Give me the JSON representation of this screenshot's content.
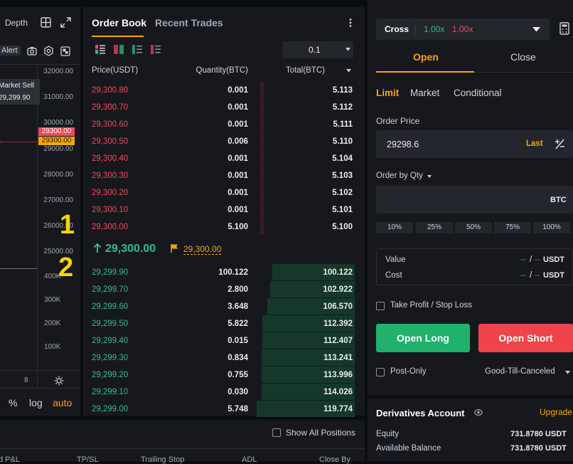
{
  "chart": {
    "depth_label": "Depth",
    "alert_label": "Alert",
    "tooltip": {
      "title": "Market Sell",
      "value": "29,299.90"
    },
    "price_axis": [
      "32000.00",
      "31000.00",
      "30000.00",
      "29000.00",
      "28000.00",
      "27000.00",
      "26000.00",
      "25000.00"
    ],
    "red_tag": "29300.00",
    "orange_tag": "29300.00",
    "volume_axis": [
      "400K",
      "300K",
      "200K",
      "100K"
    ],
    "x_tick": "8",
    "bottom_percent": "%",
    "bottom_log": "log",
    "bottom_auto": "auto",
    "marker_1": "1",
    "marker_2": "2"
  },
  "orderbook": {
    "tabs": [
      "Order Book",
      "Recent Trades"
    ],
    "precision": "0.1",
    "headers": {
      "price": "Price(USDT)",
      "qty": "Quantity(BTC)",
      "total": "Total(BTC)"
    },
    "asks": [
      {
        "price": "29,300.80",
        "qty": "0.001",
        "total": "5.113",
        "fill": 0.04
      },
      {
        "price": "29,300.70",
        "qty": "0.001",
        "total": "5.112",
        "fill": 0.04
      },
      {
        "price": "29,300.60",
        "qty": "0.001",
        "total": "5.111",
        "fill": 0.04
      },
      {
        "price": "29,300.50",
        "qty": "0.006",
        "total": "5.110",
        "fill": 0.04
      },
      {
        "price": "29,300.40",
        "qty": "0.001",
        "total": "5.104",
        "fill": 0.04
      },
      {
        "price": "29,300.30",
        "qty": "0.001",
        "total": "5.103",
        "fill": 0.04
      },
      {
        "price": "29,300.20",
        "qty": "0.001",
        "total": "5.102",
        "fill": 0.04
      },
      {
        "price": "29,300.10",
        "qty": "0.001",
        "total": "5.101",
        "fill": 0.04
      },
      {
        "price": "29,300.00",
        "qty": "5.100",
        "total": "5.100",
        "fill": 0.04
      }
    ],
    "last_price": "29,300.00",
    "mark_price": "29,300.00",
    "bids": [
      {
        "price": "29,299.90",
        "qty": "100.122",
        "total": "100.122",
        "fill": 0.84
      },
      {
        "price": "29,299.70",
        "qty": "2.800",
        "total": "102.922",
        "fill": 0.86
      },
      {
        "price": "29,299.60",
        "qty": "3.648",
        "total": "106.570",
        "fill": 0.89
      },
      {
        "price": "29,299.50",
        "qty": "5.822",
        "total": "112.392",
        "fill": 0.94
      },
      {
        "price": "29,299.40",
        "qty": "0.015",
        "total": "112.407",
        "fill": 0.94
      },
      {
        "price": "29,299.30",
        "qty": "0.834",
        "total": "113.241",
        "fill": 0.95
      },
      {
        "price": "29,299.20",
        "qty": "0.755",
        "total": "113.996",
        "fill": 0.95
      },
      {
        "price": "29,299.10",
        "qty": "0.030",
        "total": "114.026",
        "fill": 0.95
      },
      {
        "price": "29,299.00",
        "qty": "5.748",
        "total": "119.774",
        "fill": 1.0
      }
    ]
  },
  "bottom": {
    "show_all": "Show All Positions",
    "columns": [
      "d P&L",
      "TP/SL",
      "Trailing Stop",
      "ADL",
      "Close By"
    ]
  },
  "order": {
    "margin_mode": "Cross",
    "leverage_long": "1.00x",
    "leverage_short": "1.00x",
    "tabs": [
      "Open",
      "Close"
    ],
    "types": [
      "Limit",
      "Market",
      "Conditional"
    ],
    "order_price_label": "Order Price",
    "order_price_value": "29298.6",
    "last_label": "Last",
    "qty_label": "Order by Qty",
    "qty_unit": "BTC",
    "percents": [
      "10%",
      "25%",
      "50%",
      "75%",
      "100%"
    ],
    "value_label": "Value",
    "cost_label": "Cost",
    "value_dash_1": "--",
    "value_slash": "/",
    "value_dash_2": "--",
    "cost_dash_1": "--",
    "cost_slash": "/",
    "cost_dash_2": "--",
    "unit_usdt": "USDT",
    "tpsl_label": "Take Profit / Stop Loss",
    "open_long": "Open Long",
    "open_short": "Open Short",
    "post_only": "Post-Only",
    "tif": "Good-Till-Canceled",
    "account_title": "Derivatives Account",
    "upgrade": "Upgrade",
    "equity_label": "Equity",
    "equity_value": "731.8780 USDT",
    "balance_label": "Available Balance",
    "balance_value": "731.8780 USDT"
  },
  "colors": {
    "red": "#f6465d",
    "green": "#2ebd85",
    "orange": "#f7a600",
    "panel": "#17181e"
  }
}
